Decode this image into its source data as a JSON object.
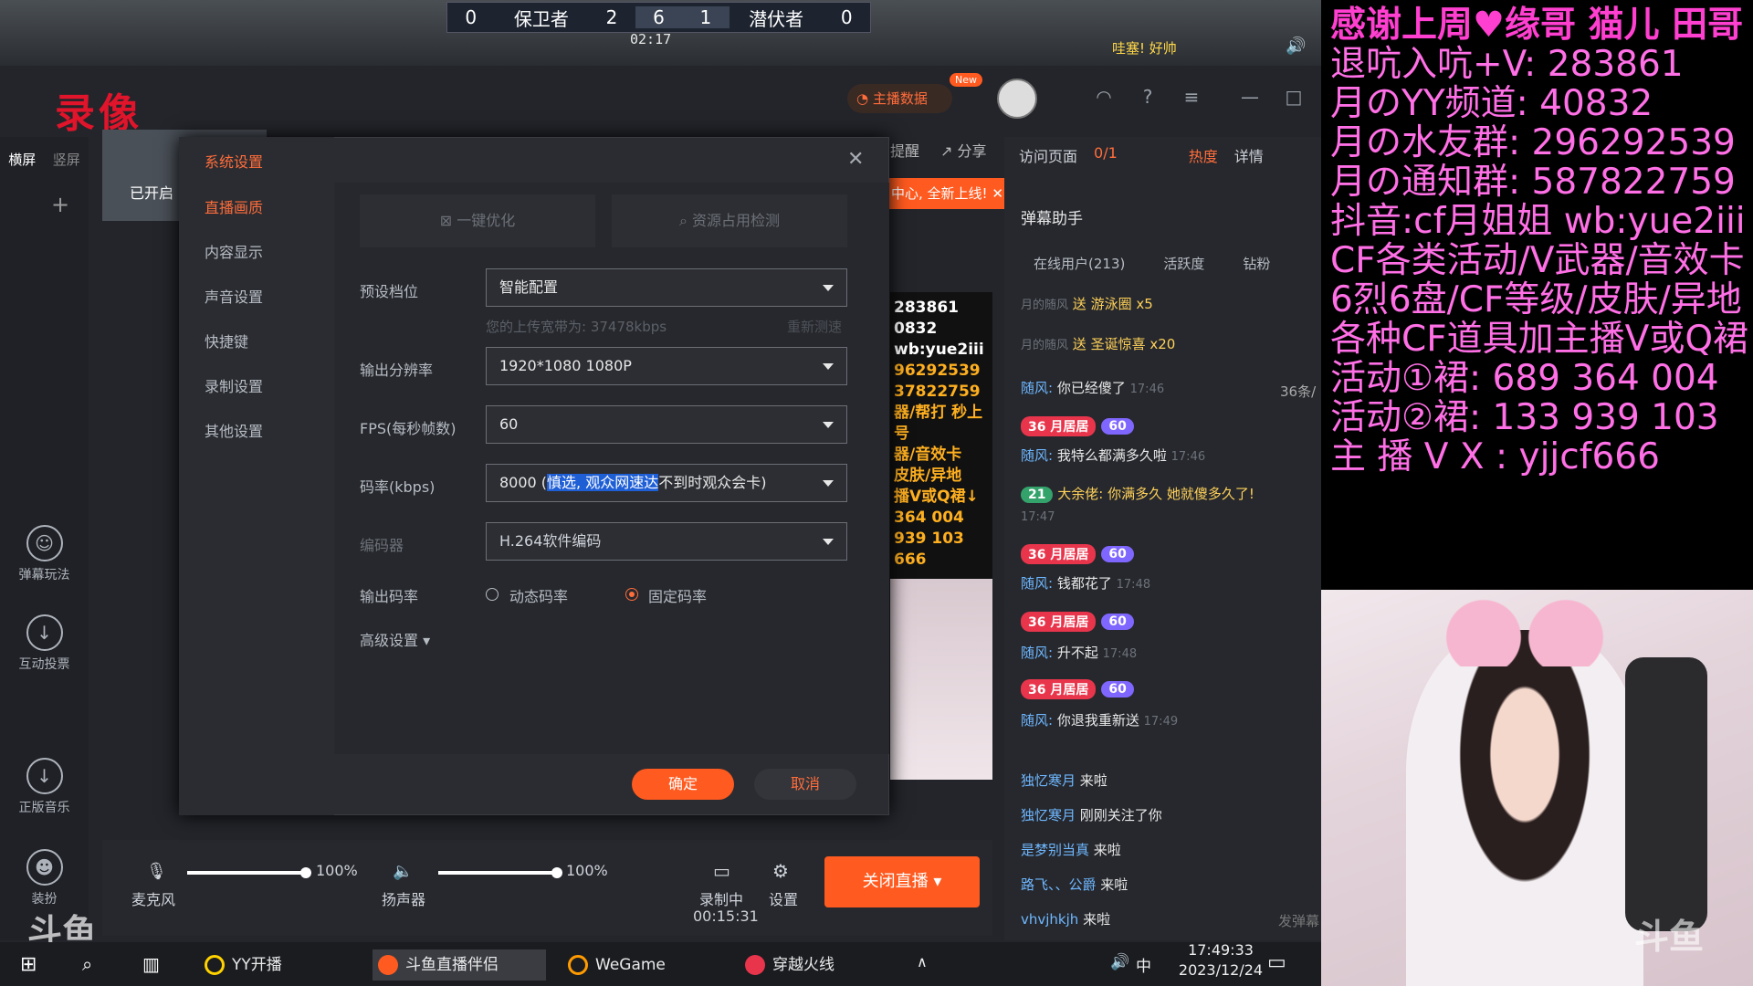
{
  "game_hud": {
    "score_left": "0",
    "team_left": "保卫者",
    "kills_left": "2",
    "round_mid_left": "6",
    "round_mid_right": "1",
    "team_right": "潜伏者",
    "score_right": "0",
    "timer": "02:17",
    "alert_text": "哇塞! 好帅"
  },
  "record_title": "录像",
  "orientation_tabs": [
    "横屏",
    "竖屏"
  ],
  "left_tools": [
    {
      "icon": "danmu-play-icon",
      "label": "弹幕玩法"
    },
    {
      "icon": "vote-icon",
      "label": "互动投票"
    },
    {
      "icon": "music-icon",
      "label": "正版音乐"
    },
    {
      "icon": "decor-icon",
      "label": "装扮"
    }
  ],
  "header": {
    "anchor_data_label": "主播数据",
    "new_badge": "New",
    "reminder_tab": "提醒",
    "share_tab": "分享"
  },
  "scene": {
    "thumb_label": "已开启"
  },
  "toast": "中心, 全新上线!",
  "preview_strip_lines": [
    "283861",
    "0832",
    "wb:yue2iii",
    "96292539",
    "37822759",
    "器/帮打 秒上号",
    "器/音效卡",
    "皮肤/异地",
    "播V或Q裙↓",
    "364 004",
    "939 103",
    "666"
  ],
  "chat": {
    "visit_label": "访问页面",
    "visit_count": "0/1",
    "hot_label": "热度",
    "detail_label": "详情",
    "title": "弹幕助手",
    "tabs": [
      "在线用户(213)",
      "活跃度",
      "钻粉"
    ],
    "gift_rows": [
      {
        "user": "月的随风",
        "text": "送 游泳圈",
        "count": "x5"
      },
      {
        "user": "月的随风",
        "text": "送 圣诞惊喜",
        "count": "x20"
      }
    ],
    "count_label": "36条/",
    "messages": [
      {
        "user": "随风:",
        "text": "你已经傻了",
        "time": "17:46"
      },
      {
        "user": "随风:",
        "text": "我特么都满多久啦",
        "time": "17:46"
      },
      {
        "user": "大余佬:",
        "text": "你满多久 她就傻多久了!",
        "time": "17:47"
      },
      {
        "user": "随风:",
        "text": "钱都花了",
        "time": "17:48"
      },
      {
        "user": "随风:",
        "text": "升不起",
        "time": "17:48"
      },
      {
        "user": "随风:",
        "text": "你退我重新送",
        "time": "17:49"
      }
    ],
    "badge_level": "36",
    "badge_name": "月居居",
    "vip_level": "60",
    "vip_level_2": "21",
    "joins": [
      {
        "user": "独忆寒月",
        "text": "来啦"
      },
      {
        "user": "独忆寒月",
        "text": "刚刚关注了你"
      },
      {
        "user": "是梦别当真",
        "text": "来啦"
      },
      {
        "user": "路飞、、公爵",
        "text": "来啦"
      },
      {
        "user": "vhvjhkjh",
        "text": "来啦"
      }
    ],
    "send_label": "发弹幕"
  },
  "controls": {
    "mic_label": "麦克风",
    "mic_value": "100%",
    "speaker_label": "扬声器",
    "speaker_value": "100%",
    "recording_label": "录制中",
    "recording_time": "00:15:31",
    "settings_label": "设置",
    "close_live_label": "关闭直播"
  },
  "dialog": {
    "title": "系统设置",
    "nav": [
      "直播画质",
      "内容显示",
      "声音设置",
      "快捷键",
      "录制设置",
      "其他设置"
    ],
    "active_nav": 0,
    "one_click_optimize": "一键优化",
    "resource_check": "资源占用检测",
    "preset_label": "预设档位",
    "preset_value": "智能配置",
    "upload_hint": "您的上传宽带为: 37478kbps",
    "retest_label": "重新测速",
    "resolution_label": "输出分辨率",
    "resolution_value": "1920*1080 1080P",
    "fps_label": "FPS(每秒帧数)",
    "fps_value": "60",
    "bitrate_label": "码率(kbps)",
    "bitrate_prefix": "8000 (",
    "bitrate_selected": "慎选, 观众网速达",
    "bitrate_suffix": "不到时观众会卡)",
    "encoder_label": "编码器",
    "encoder_value": "H.264软件编码",
    "output_rate_label": "输出码率",
    "dynamic_rate": "动态码率",
    "fixed_rate": "固定码率",
    "advanced_label": "高级设置",
    "ok_label": "确定",
    "cancel_label": "取消"
  },
  "taskbar": {
    "items": [
      "YY开播",
      "斗鱼直播伴侣",
      "WeGame",
      "穿越火线"
    ],
    "ime": "中",
    "time": "17:49:33",
    "date": "2023/12/24"
  },
  "overlay_lines": [
    "感谢上周♥缘哥 猫儿 田哥",
    "退吭入吭+V: 283861",
    "月のYY频道: 40832",
    "月の水友群: 296292539",
    "月の通知群: 587822759",
    "抖音:cf月姐姐 wb:yue2iii",
    "CF各类活动/V武器/音效卡",
    "6烈6盘/CF等级/皮肤/异地",
    "各种CF道具加主播V或Q裙↓",
    "活动①裙: 689 364 004",
    "活动②裙: 133 939 103",
    "主 播 V X : yjjcf666"
  ],
  "watermark": "斗鱼",
  "colors": {
    "accent": "#ff5a1f",
    "overlay_text": "#ff6fe6"
  }
}
